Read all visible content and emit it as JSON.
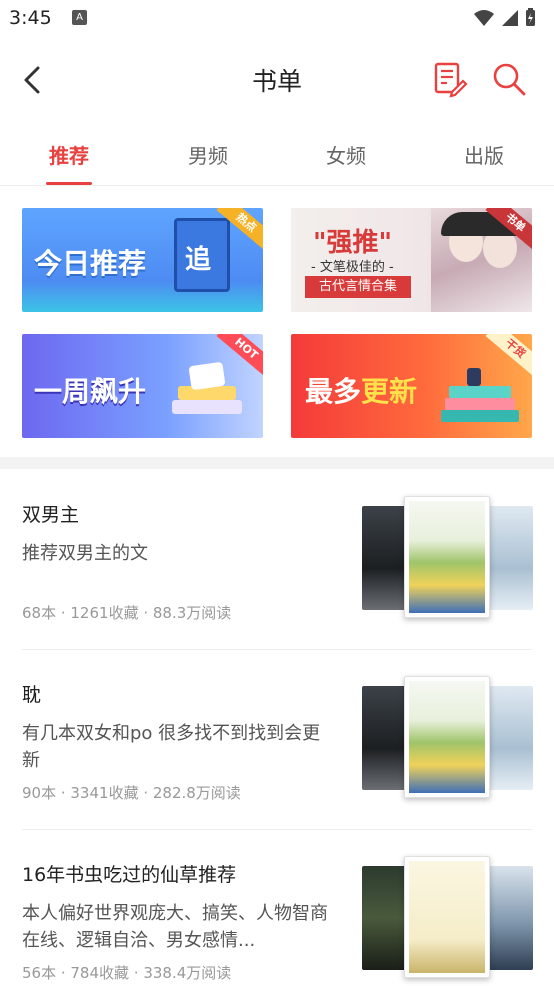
{
  "status_bar": {
    "time": "3:45",
    "notification_badge": "A"
  },
  "header": {
    "title": "书单"
  },
  "tabs": [
    {
      "label": "推荐",
      "active": true
    },
    {
      "label": "男频",
      "active": false
    },
    {
      "label": "女频",
      "active": false
    },
    {
      "label": "出版",
      "active": false
    }
  ],
  "banners": [
    {
      "text": "今日推荐",
      "icon_text": "追",
      "corner": "热点"
    },
    {
      "line1": "\"强推\"",
      "line2": "- 文笔极佳的 -",
      "line3": "古代言情合集",
      "corner": "书单"
    },
    {
      "text": "一周飙升",
      "corner": "HOT"
    },
    {
      "text_a": "最多",
      "text_b": "更新",
      "corner": "干货"
    }
  ],
  "lists": [
    {
      "title": "双男主",
      "desc": "推荐双男主的文",
      "meta": "68本 · 1261收藏 · 88.3万阅读"
    },
    {
      "title": "耽",
      "desc": "有几本双女和po 很多找不到找到会更新",
      "meta": "90本 · 3341收藏 · 282.8万阅读"
    },
    {
      "title": "16年书虫吃过的仙草推荐",
      "desc": "本人偏好世界观庞大、搞笑、人物智商在线、逻辑自洽、男女感情...",
      "meta": "56本 · 784收藏 · 338.4万阅读"
    }
  ],
  "colors": {
    "accent": "#e8413f",
    "muted": "#999999"
  }
}
